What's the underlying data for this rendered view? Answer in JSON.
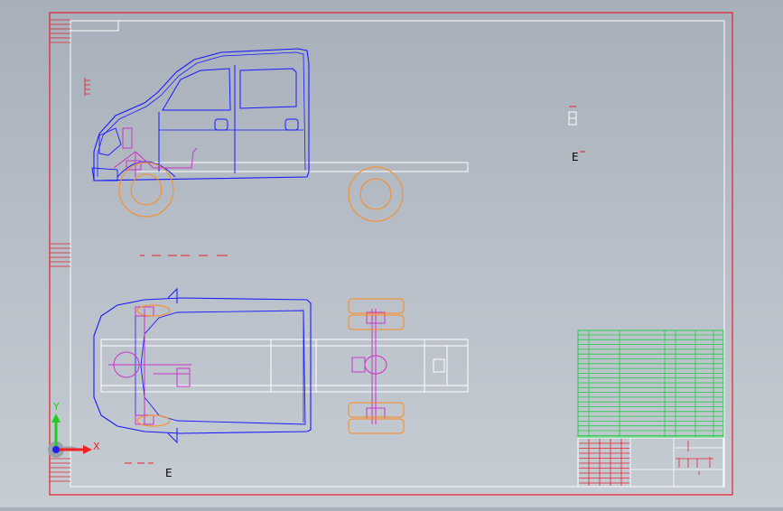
{
  "view": {
    "background_top": "#a7afba",
    "background_bottom": "#c6ccd3"
  },
  "colors": {
    "frame": "#e8202a",
    "sheet_border": "#ffffff",
    "body_lines": "#1a1aff",
    "chassis_lines": "#ffffff",
    "wheels": "#ff8a1a",
    "suspension": "#cc33cc",
    "title_grid": "#22cc44",
    "axis_y": "#22cc22",
    "axis_x": "#ee2222",
    "axis_z": "#2222ee"
  },
  "labels": {
    "section_mark_right": "E",
    "section_mark_bottom": "E"
  },
  "axes": {
    "x_label": "X",
    "y_label": "Y"
  },
  "icons": {
    "triad": "coordinate-triad-icon"
  }
}
